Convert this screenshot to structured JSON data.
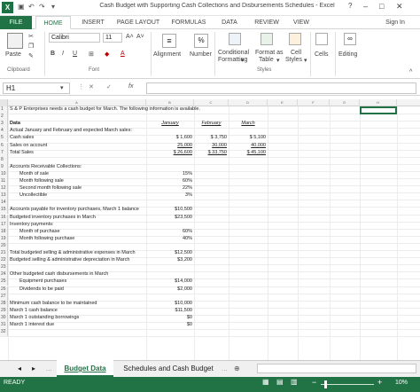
{
  "window": {
    "title": "Cash Budget with Supporting Cash Collections and Disbursements Schedules - Excel",
    "help": "?",
    "sign_in": "Sign In"
  },
  "ribbon_tabs": [
    "FILE",
    "HOME",
    "INSERT",
    "PAGE LAYOUT",
    "FORMULAS",
    "DATA",
    "REVIEW",
    "VIEW"
  ],
  "ribbon": {
    "paste": "Paste",
    "clipboard": "Clipboard",
    "font_name": "Calibri",
    "font_size": "11",
    "font": "Font",
    "alignment": "Alignment",
    "number": "Number",
    "percent": "%",
    "conditional": "Conditional",
    "formatting": "Formatting",
    "format_as": "Format as",
    "table": "Table",
    "cell": "Cell",
    "styles_word": "Styles",
    "styles": "Styles",
    "cells": "Cells",
    "editing": "Editing",
    "bold": "B",
    "italic": "I",
    "underline": "U"
  },
  "formula_bar": {
    "name_box": "H1",
    "fx": "fx",
    "cancel": "✕",
    "enter": "✓"
  },
  "columns": [
    "A",
    "B",
    "C",
    "D",
    "E",
    "F",
    "G",
    "H"
  ],
  "rows": [
    {
      "n": "1",
      "a": "S & P Enterprises needs a cash budget for March. The following information is available."
    },
    {
      "n": "2"
    },
    {
      "n": "3",
      "a": "Data",
      "b": "January",
      "c": "February",
      "d": "March"
    },
    {
      "n": "4",
      "a": "Actual January and February and expected March sales:"
    },
    {
      "n": "5",
      "a": "Cash sales",
      "b": "$    1,600",
      "c": "$   3,750",
      "d": "$   5,100"
    },
    {
      "n": "6",
      "a": "Sales on account",
      "b": "25,000",
      "c": "30,000",
      "d": "40,000"
    },
    {
      "n": "7",
      "a": "Total Sales",
      "b": "$  26,600",
      "c": "$  33,750",
      "d": "$  45,100"
    },
    {
      "n": "8"
    },
    {
      "n": "9",
      "a": "Accounts Receivable Collections:"
    },
    {
      "n": "10",
      "a": "Month of sale",
      "b": "15%"
    },
    {
      "n": "11",
      "a": "Month following sale",
      "b": "60%"
    },
    {
      "n": "12",
      "a": "Second month following sale",
      "b": "22%"
    },
    {
      "n": "13",
      "a": "Uncollectible",
      "b": "3%"
    },
    {
      "n": "14"
    },
    {
      "n": "15",
      "a": "Accounts payable for inventory purchases, March 1 balance",
      "b": "$10,500"
    },
    {
      "n": "16",
      "a": "Budgeted inventory purchases in March",
      "b": "$23,500"
    },
    {
      "n": "17",
      "a": "Inventory payments:"
    },
    {
      "n": "18",
      "a": "Month of purchase",
      "b": "60%"
    },
    {
      "n": "19",
      "a": "Month following purchase",
      "b": "40%"
    },
    {
      "n": "20"
    },
    {
      "n": "21",
      "a": "Total budgeted selling & administrative expenses in March",
      "b": "$12,500"
    },
    {
      "n": "22",
      "a": "Budgeted selling & administrative depreciation in March",
      "b": "$3,200"
    },
    {
      "n": "23"
    },
    {
      "n": "24",
      "a": "Other budgeted cash disbursements in March"
    },
    {
      "n": "25",
      "a": "Equipment purchases",
      "b": "$14,000"
    },
    {
      "n": "26",
      "a": "Dividends to be paid",
      "b": "$2,000"
    },
    {
      "n": "27"
    },
    {
      "n": "28",
      "a": "Minimum cash balance to be maintained",
      "b": "$10,000"
    },
    {
      "n": "29",
      "a": "March 1 cash balance",
      "b": "$11,500"
    },
    {
      "n": "30",
      "a": "March 1 outstanding borrowings",
      "b": "$0"
    },
    {
      "n": "31",
      "a": "March 1 interest due",
      "b": "$0"
    },
    {
      "n": "32"
    }
  ],
  "sheets": {
    "active": "Budget Data",
    "other": "Schedules and Cash Budget",
    "add": "⊕",
    "more": "..."
  },
  "status": {
    "ready": "READY",
    "zoom": "10%",
    "minus": "−",
    "plus": "+"
  }
}
